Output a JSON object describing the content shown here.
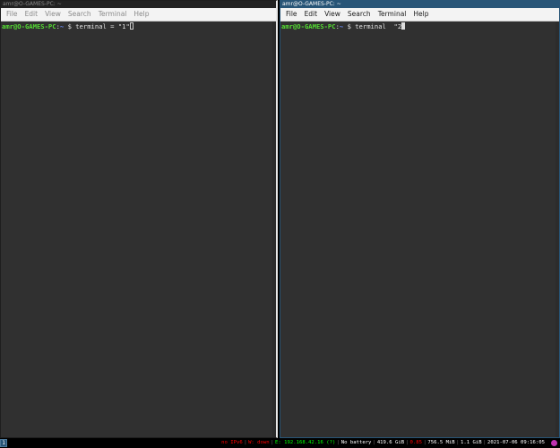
{
  "colors": {
    "terminal_bg": "#303030",
    "prompt_user": "#55dd33",
    "prompt_path": "#6f8fff",
    "focused_title": "#285577",
    "ipv6_down": "#ff0000",
    "ethernet_up": "#00ff00",
    "disk": "#ffffff",
    "load_warn": "#ff0000"
  },
  "windows": [
    {
      "title": "amr@O-GAMES-PC: ~",
      "focused": false,
      "menu": [
        "File",
        "Edit",
        "View",
        "Search",
        "Terminal",
        "Help"
      ],
      "prompt": {
        "user_host": "amr@O-GAMES-PC",
        "colon": ":",
        "path": "~",
        "dollar": "$",
        "command": "terminal = \"1\""
      }
    },
    {
      "title": "amr@O-GAMES-PC: ~",
      "focused": true,
      "menu": [
        "File",
        "Edit",
        "View",
        "Search",
        "Terminal",
        "Help"
      ],
      "prompt": {
        "user_host": "amr@O-GAMES-PC",
        "colon": ":",
        "path": "~",
        "dollar": "$",
        "command": "terminal  \"2"
      }
    }
  ],
  "statusbar": {
    "workspace": "1",
    "ipv6": "no IPv6",
    "wireless": "W: down",
    "ethernet": "E: 192.168.42.16 (?)",
    "battery": "No battery",
    "disk": "419.6 GiB",
    "load": "0.85",
    "memory_used": "756.5 MiB",
    "memory_avail": "1.1 GiB",
    "datetime": "2021-07-06 09:16:05"
  }
}
